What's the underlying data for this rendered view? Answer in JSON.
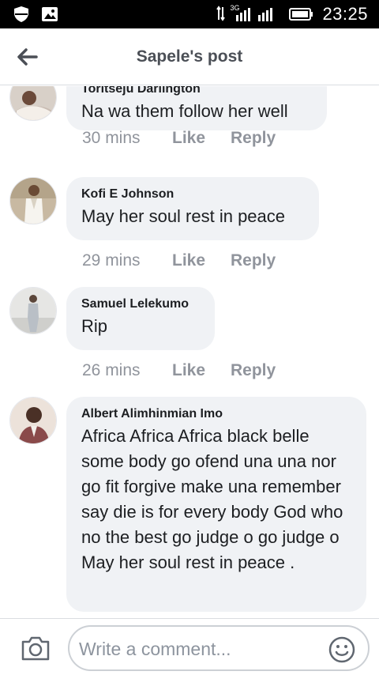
{
  "status_bar": {
    "time": "23:25",
    "network": "3G",
    "icons": [
      "shield-icon",
      "gallery-icon",
      "network-signal-icon",
      "battery-icon"
    ]
  },
  "header": {
    "title": "Sapele's post",
    "back_icon": "arrow-left-icon"
  },
  "comments": [
    {
      "author": "Toritseju Darlington",
      "text": "Na wa them follow her well",
      "time": "30 mins",
      "like_label": "Like",
      "reply_label": "Reply"
    },
    {
      "author": "Kofi E Johnson",
      "text": "May her soul rest in peace",
      "time": "29 mins",
      "like_label": "Like",
      "reply_label": "Reply"
    },
    {
      "author": "Samuel Lelekumo",
      "text": "Rip",
      "time": "26 mins",
      "like_label": "Like",
      "reply_label": "Reply"
    },
    {
      "author": "Albert Alimhinmian Imo",
      "text": "Africa Africa Africa black belle some body go ofend  una una nor go fit forgive make una remember say die is for every body  God who no the best go judge o go judge o May her soul rest in peace ."
    }
  ],
  "composer": {
    "placeholder": "Write a comment...",
    "camera_icon": "camera-icon",
    "emoji_icon": "emoji-icon"
  }
}
